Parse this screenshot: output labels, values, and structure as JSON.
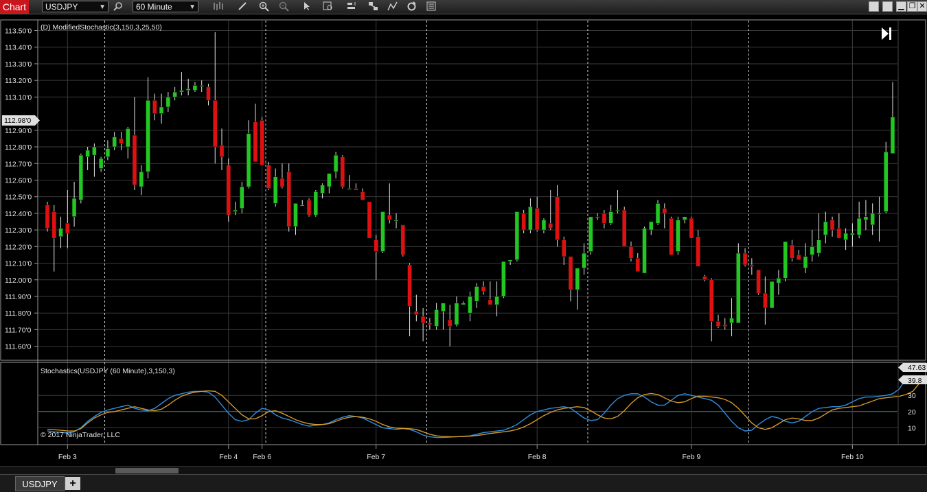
{
  "toolbar": {
    "chart_tab": "Chart",
    "instrument": "USDJPY",
    "interval": "60 Minute",
    "icons": [
      "search-icon",
      "bar-type-icon",
      "pencil-icon",
      "zoom-in-icon",
      "zoom-out-icon",
      "pointer-icon",
      "data-box-icon",
      "indicators-icon",
      "strategies-icon",
      "drawing-tools-icon",
      "refresh-icon",
      "properties-icon"
    ]
  },
  "window_buttons": [
    "minimize",
    "restore",
    "maximize",
    "close"
  ],
  "price_panel": {
    "indicator_label": "(D) ModifiedStochastic(3,150,3,25,50)",
    "current_price": "112.98'0",
    "price_ticks": [
      "113.50'0",
      "113.40'0",
      "113.30'0",
      "113.20'0",
      "113.10'0",
      "112.90'0",
      "112.80'0",
      "112.70'0",
      "112.60'0",
      "112.50'0",
      "112.40'0",
      "112.30'0",
      "112.20'0",
      "112.10'0",
      "112.00'0",
      "111.90'0",
      "111.80'0",
      "111.70'0",
      "111.60'0"
    ]
  },
  "stoch_panel": {
    "label": "Stochastics(USDJPY (60 Minute),3,150,3)",
    "copyright": "© 2017 NinjaTrader, LLC",
    "value_d": "47.63",
    "value_k": "39.8",
    "ticks": [
      "30",
      "20",
      "10"
    ]
  },
  "x_axis": {
    "labels": [
      "Feb 3",
      "Feb 4",
      "Feb 6",
      "Feb 7",
      "Feb 8",
      "Feb 9",
      "Feb 10"
    ]
  },
  "bottom_tab": {
    "instrument": "USDJPY",
    "add_label": "+"
  },
  "colors": {
    "up": "#22c722",
    "down": "#e01010",
    "stoch_k": "#2f8fe0",
    "stoch_d": "#d49a2a",
    "grid": "#3a3a3a"
  },
  "chart_data": [
    {
      "type": "candlestick",
      "ylim": [
        111.52,
        113.56
      ],
      "candles": [
        [
          112.45,
          112.47,
          112.29,
          112.31
        ],
        [
          112.41,
          112.45,
          112.05,
          112.25
        ],
        [
          112.26,
          112.38,
          112.19,
          112.31
        ],
        [
          112.34,
          112.54,
          112.19,
          112.28
        ],
        [
          112.38,
          112.59,
          112.32,
          112.49
        ],
        [
          112.48,
          112.76,
          112.46,
          112.75
        ],
        [
          112.74,
          112.8,
          112.66,
          112.78
        ],
        [
          112.75,
          112.82,
          112.62,
          112.8
        ],
        [
          112.67,
          112.74,
          112.65,
          112.73
        ],
        [
          112.74,
          112.84,
          112.72,
          112.79
        ],
        [
          112.8,
          112.89,
          112.78,
          112.86
        ],
        [
          112.85,
          112.89,
          112.78,
          112.82
        ],
        [
          112.8,
          112.92,
          112.73,
          112.91
        ],
        [
          112.87,
          113.1,
          112.54,
          112.57
        ],
        [
          112.56,
          112.69,
          112.51,
          112.65
        ],
        [
          112.65,
          113.22,
          112.61,
          113.08
        ],
        [
          113.08,
          113.12,
          112.96,
          113.0
        ],
        [
          113.0,
          113.12,
          112.94,
          113.04
        ],
        [
          113.04,
          113.13,
          113.01,
          113.1
        ],
        [
          113.1,
          113.16,
          113.08,
          113.13
        ],
        [
          113.13,
          113.25,
          113.11,
          113.14
        ],
        [
          113.14,
          113.21,
          113.11,
          113.15
        ],
        [
          113.14,
          113.19,
          113.13,
          113.17
        ],
        [
          113.17,
          113.2,
          113.13,
          113.17
        ],
        [
          113.16,
          113.18,
          113.05,
          113.08
        ],
        [
          113.08,
          113.49,
          112.7,
          112.8
        ],
        [
          112.81,
          112.91,
          112.66,
          112.74
        ],
        [
          112.69,
          112.73,
          112.35,
          112.39
        ],
        [
          112.41,
          112.47,
          112.39,
          112.42
        ],
        [
          112.43,
          112.59,
          112.4,
          112.56
        ],
        [
          112.56,
          112.96,
          112.55,
          112.88
        ],
        [
          112.95,
          113.06,
          112.73,
          112.71
        ],
        [
          112.96,
          112.98,
          112.69,
          112.69
        ],
        [
          112.69,
          112.71,
          112.54,
          112.55
        ],
        [
          112.46,
          112.67,
          112.44,
          112.62
        ],
        [
          112.61,
          112.7,
          112.55,
          112.56
        ],
        [
          112.65,
          112.7,
          112.29,
          112.32
        ],
        [
          112.32,
          112.43,
          112.27,
          112.46
        ],
        [
          112.45,
          112.48,
          112.45,
          112.45
        ],
        [
          112.48,
          112.49,
          112.38,
          112.39
        ],
        [
          112.39,
          112.54,
          112.38,
          112.53
        ],
        [
          112.52,
          112.58,
          112.49,
          112.57
        ],
        [
          112.56,
          112.64,
          112.52,
          112.64
        ],
        [
          112.65,
          112.77,
          112.61,
          112.75
        ],
        [
          112.74,
          112.75,
          112.55,
          112.56
        ],
        [
          112.55,
          112.63,
          112.55,
          112.55
        ],
        [
          112.55,
          112.58,
          112.55,
          112.54
        ],
        [
          112.53,
          112.55,
          112.48,
          112.48
        ],
        [
          112.47,
          112.47,
          112.25,
          112.25
        ],
        [
          112.24,
          112.27,
          112.0,
          112.17
        ],
        [
          112.17,
          112.4,
          112.16,
          112.41
        ],
        [
          112.39,
          112.58,
          112.34,
          112.36
        ],
        [
          112.36,
          112.4,
          112.31,
          112.36
        ],
        [
          112.33,
          112.33,
          112.14,
          112.15
        ],
        [
          112.09,
          112.1,
          111.66,
          111.84
        ],
        [
          111.81,
          111.91,
          111.75,
          111.79
        ],
        [
          111.78,
          111.83,
          111.63,
          111.74
        ],
        [
          111.74,
          111.77,
          111.7,
          111.73
        ],
        [
          111.72,
          111.86,
          111.7,
          111.82
        ],
        [
          111.81,
          111.86,
          111.7,
          111.86
        ],
        [
          111.76,
          111.85,
          111.6,
          111.72
        ],
        [
          111.73,
          111.9,
          111.72,
          111.86
        ],
        [
          111.85,
          111.87,
          111.85,
          111.86
        ],
        [
          111.8,
          111.93,
          111.75,
          111.9
        ],
        [
          111.87,
          111.98,
          111.83,
          111.96
        ],
        [
          111.96,
          111.99,
          111.91,
          111.93
        ],
        [
          111.88,
          111.99,
          111.88,
          111.85
        ],
        [
          111.85,
          111.99,
          111.78,
          111.9
        ],
        [
          111.9,
          112.07,
          111.89,
          112.11
        ],
        [
          112.11,
          112.12,
          112.09,
          112.12
        ],
        [
          112.12,
          112.28,
          112.11,
          112.41
        ],
        [
          112.4,
          112.42,
          112.28,
          112.3
        ],
        [
          112.3,
          112.49,
          112.28,
          112.44
        ],
        [
          112.43,
          112.5,
          112.29,
          112.3
        ],
        [
          112.3,
          112.37,
          112.28,
          112.36
        ],
        [
          112.34,
          112.54,
          112.3,
          112.31
        ],
        [
          112.5,
          112.57,
          112.2,
          112.24
        ],
        [
          112.24,
          112.26,
          112.09,
          112.14
        ],
        [
          112.14,
          112.14,
          111.87,
          111.94
        ],
        [
          111.94,
          112.05,
          111.82,
          112.07
        ],
        [
          112.07,
          112.22,
          112.03,
          112.16
        ],
        [
          112.17,
          112.37,
          112.15,
          112.38
        ],
        [
          112.38,
          112.4,
          112.36,
          112.38
        ],
        [
          112.4,
          112.42,
          112.31,
          112.34
        ],
        [
          112.34,
          112.45,
          112.33,
          112.41
        ],
        [
          112.42,
          112.54,
          112.4,
          112.42
        ],
        [
          112.42,
          112.44,
          112.2,
          112.2
        ],
        [
          112.2,
          112.23,
          112.11,
          112.13
        ],
        [
          112.13,
          112.16,
          112.05,
          112.05
        ],
        [
          112.04,
          112.32,
          112.05,
          112.31
        ],
        [
          112.3,
          112.35,
          112.27,
          112.35
        ],
        [
          112.34,
          112.48,
          112.33,
          112.46
        ],
        [
          112.43,
          112.46,
          112.31,
          112.4
        ],
        [
          112.37,
          112.38,
          112.15,
          112.15
        ],
        [
          112.17,
          112.38,
          112.15,
          112.36
        ],
        [
          112.36,
          112.38,
          112.34,
          112.38
        ],
        [
          112.37,
          112.38,
          112.25,
          112.25
        ],
        [
          112.26,
          112.3,
          112.08,
          112.08
        ],
        [
          112.02,
          112.03,
          111.99,
          112.0
        ],
        [
          112.0,
          112.01,
          111.63,
          111.75
        ],
        [
          111.75,
          111.79,
          111.71,
          111.72
        ],
        [
          111.73,
          111.77,
          111.7,
          111.72
        ],
        [
          111.74,
          111.89,
          111.66,
          111.77
        ],
        [
          111.74,
          112.22,
          111.74,
          112.16
        ],
        [
          112.16,
          112.19,
          112.08,
          112.09
        ],
        [
          112.09,
          112.13,
          112.03,
          112.08
        ],
        [
          112.06,
          112.06,
          111.91,
          111.92
        ],
        [
          111.92,
          112.02,
          111.73,
          111.83
        ],
        [
          111.83,
          111.98,
          111.84,
          111.99
        ],
        [
          111.98,
          112.06,
          111.91,
          112.01
        ],
        [
          112.01,
          112.23,
          111.99,
          112.23
        ],
        [
          112.21,
          112.24,
          112.11,
          112.13
        ],
        [
          112.15,
          112.18,
          112.12,
          112.12
        ],
        [
          112.07,
          112.22,
          112.04,
          112.14
        ],
        [
          112.15,
          112.3,
          112.11,
          112.2
        ],
        [
          112.16,
          112.4,
          112.14,
          112.24
        ],
        [
          112.27,
          112.41,
          112.22,
          112.35
        ],
        [
          112.36,
          112.38,
          112.26,
          112.3
        ],
        [
          112.31,
          112.4,
          112.25,
          112.25
        ],
        [
          112.24,
          112.31,
          112.18,
          112.28
        ],
        [
          112.27,
          112.34,
          112.2,
          112.28
        ],
        [
          112.27,
          112.47,
          112.25,
          112.37
        ],
        [
          112.36,
          112.48,
          112.3,
          112.38
        ],
        [
          112.33,
          112.46,
          112.27,
          112.4
        ],
        [
          112.4,
          112.5,
          112.23,
          112.4
        ],
        [
          112.41,
          112.83,
          112.4,
          112.77
        ],
        [
          112.76,
          113.19,
          112.76,
          112.98
        ]
      ]
    },
    {
      "type": "line",
      "ylim": [
        0,
        50
      ],
      "series": [
        {
          "name": "K",
          "values": [
            8,
            7.5,
            7.2,
            6.8,
            7.5,
            10,
            14,
            17,
            19.5,
            21,
            22,
            23,
            24,
            22,
            21,
            20.5,
            22,
            25,
            28,
            30,
            31,
            32,
            32.5,
            32.5,
            32,
            29,
            24,
            19,
            15,
            14,
            15,
            19,
            22,
            21,
            18,
            16,
            15,
            13.5,
            12,
            11,
            11.5,
            12,
            13,
            15,
            16.5,
            17.5,
            17,
            16,
            14,
            12,
            10,
            9.5,
            9,
            9.5,
            9,
            7.5,
            5.5,
            4.5,
            4,
            4,
            4.2,
            4.5,
            4.8,
            5,
            6,
            7,
            7.5,
            8,
            8.5,
            10,
            12,
            15,
            18,
            20,
            21,
            22,
            22.5,
            23,
            22,
            19,
            16,
            14.5,
            15,
            19,
            24,
            28,
            30,
            31,
            31,
            29,
            26,
            24,
            24,
            27,
            30,
            31,
            30,
            29,
            28,
            27,
            24,
            19,
            14,
            10,
            8,
            8.5,
            12,
            15,
            17,
            16,
            14,
            13,
            14,
            17,
            20,
            22,
            22.5,
            23,
            23,
            24,
            26,
            28,
            29,
            29,
            29.5,
            30,
            31,
            34,
            40.6
          ]
        },
        {
          "name": "D",
          "values": [
            9,
            8.8,
            8.5,
            8,
            8,
            9.5,
            13,
            16,
            18,
            19.5,
            20,
            21,
            22,
            23,
            22,
            21,
            20.5,
            21.5,
            24,
            27,
            29.5,
            31,
            32,
            32.5,
            32.8,
            32.5,
            30,
            26,
            22,
            18,
            15.5,
            15.5,
            17.5,
            20,
            20.5,
            19,
            17,
            15,
            13.5,
            12.5,
            12,
            12,
            12.5,
            14,
            15.5,
            16.5,
            17,
            16.5,
            15.5,
            14,
            12,
            10.5,
            9.8,
            9.6,
            9.4,
            9,
            7.5,
            6,
            5,
            4.6,
            4.5,
            4.5,
            4.6,
            4.8,
            5.2,
            5.8,
            6.5,
            7,
            7.5,
            8,
            9,
            10.5,
            12.5,
            15,
            17.5,
            19.5,
            21,
            22,
            22.5,
            23,
            22.5,
            20.5,
            18,
            16,
            15.5,
            17,
            20.5,
            25,
            28.5,
            30.5,
            31.2,
            30.5,
            28.5,
            26.5,
            25.5,
            26,
            28,
            29.5,
            29.5,
            29,
            28.5,
            27.5,
            25.5,
            22,
            17.5,
            13,
            10,
            9,
            10,
            12.5,
            15,
            16,
            15.5,
            14.5,
            14.5,
            16,
            18.5,
            21,
            22,
            22.5,
            23,
            23.5,
            25,
            26.5,
            28,
            28.5,
            29,
            29.5,
            30.5,
            32.5,
            37.6
          ]
        }
      ],
      "levels": [
        10,
        20,
        30
      ]
    }
  ]
}
